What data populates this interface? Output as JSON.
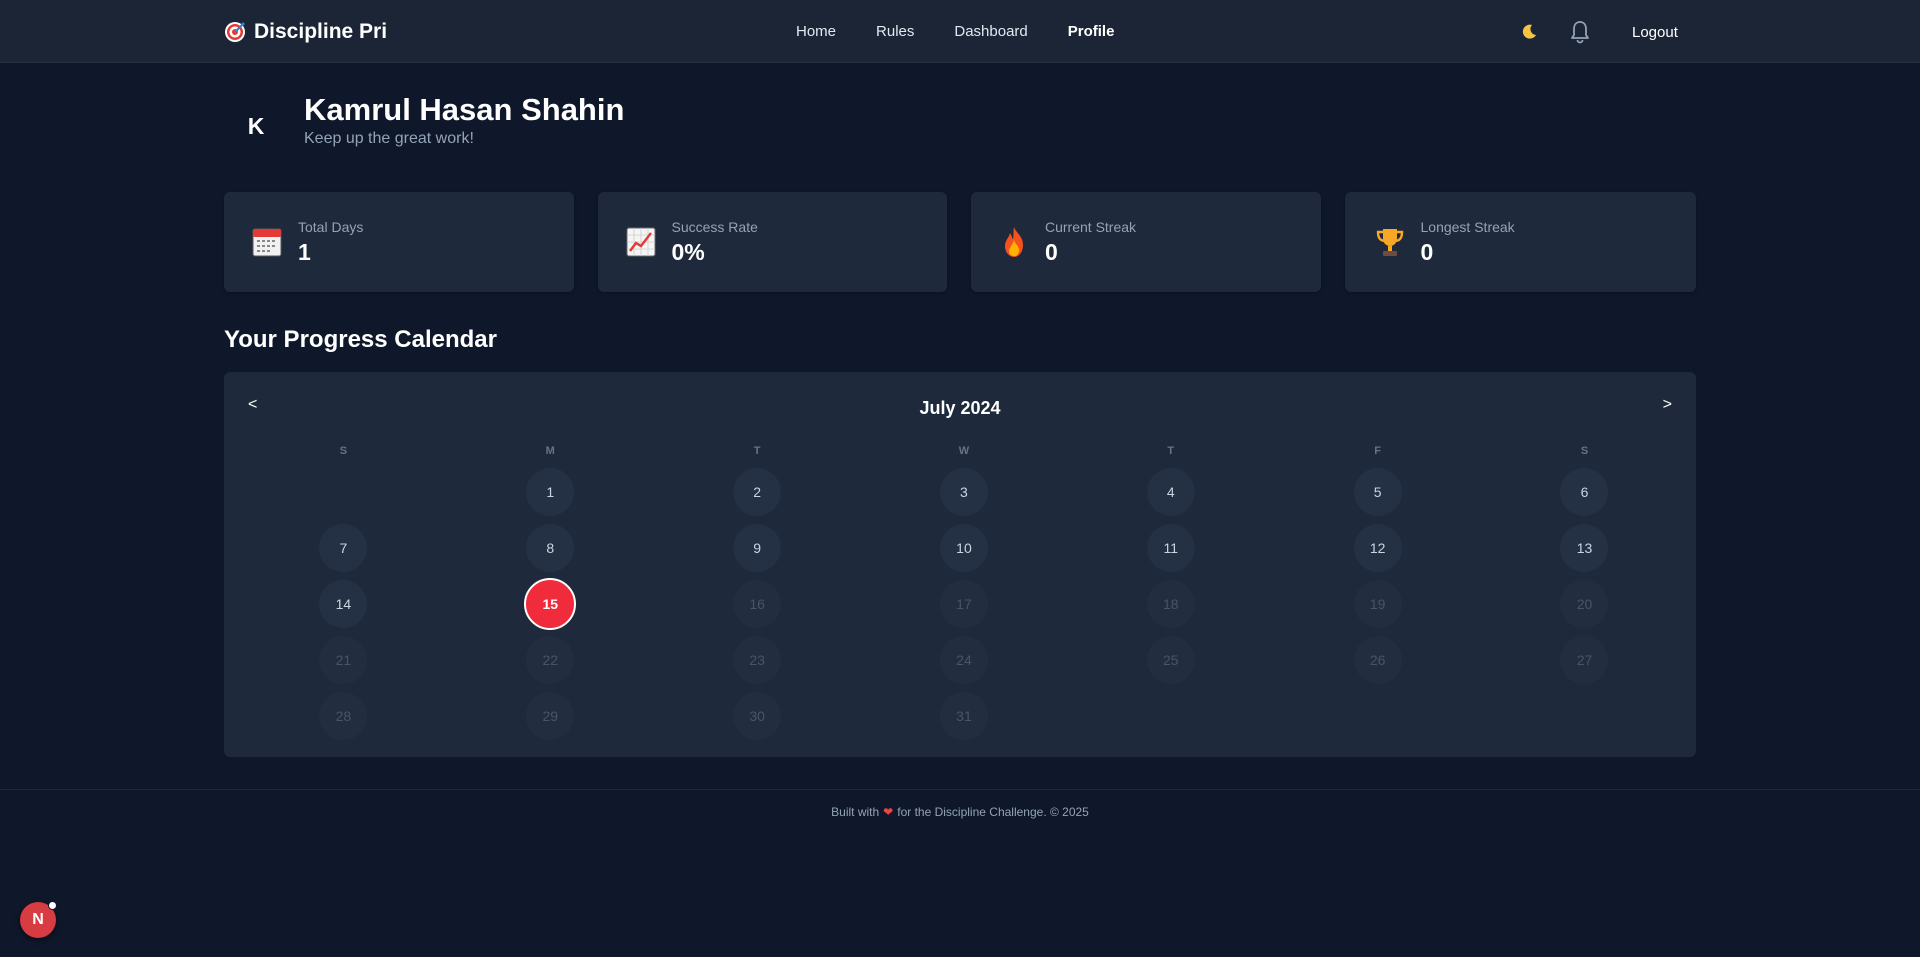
{
  "nav": {
    "brand_icon": "target-icon",
    "brand": "Discipline Pri",
    "links": [
      "Home",
      "Rules",
      "Dashboard",
      "Profile"
    ],
    "active": "Profile",
    "theme_icon": "moon-icon",
    "notifications_icon": "bell-icon",
    "logout": "Logout"
  },
  "profile": {
    "initial": "K",
    "name": "Kamrul Hasan Shahin",
    "subtitle": "Keep up the great work!"
  },
  "stats": [
    {
      "icon": "calendar-icon",
      "label": "Total Days",
      "value": "1"
    },
    {
      "icon": "chart-increasing-icon",
      "label": "Success Rate",
      "value": "0%"
    },
    {
      "icon": "fire-icon",
      "label": "Current Streak",
      "value": "0"
    },
    {
      "icon": "trophy-icon",
      "label": "Longest Streak",
      "value": "0"
    }
  ],
  "calendar": {
    "section_title": "Your Progress Calendar",
    "month": "July 2024",
    "prev": "<",
    "next": ">",
    "weekdays": [
      "S",
      "M",
      "T",
      "W",
      "T",
      "F",
      "S"
    ],
    "first_weekday": 1,
    "days_in_month": 31,
    "today": 15,
    "colors": {
      "today": "#ef2b3c"
    }
  },
  "footer": {
    "before": "Built with",
    "after": "for the Discipline Challenge. © 2025"
  },
  "corner_badge": "N"
}
